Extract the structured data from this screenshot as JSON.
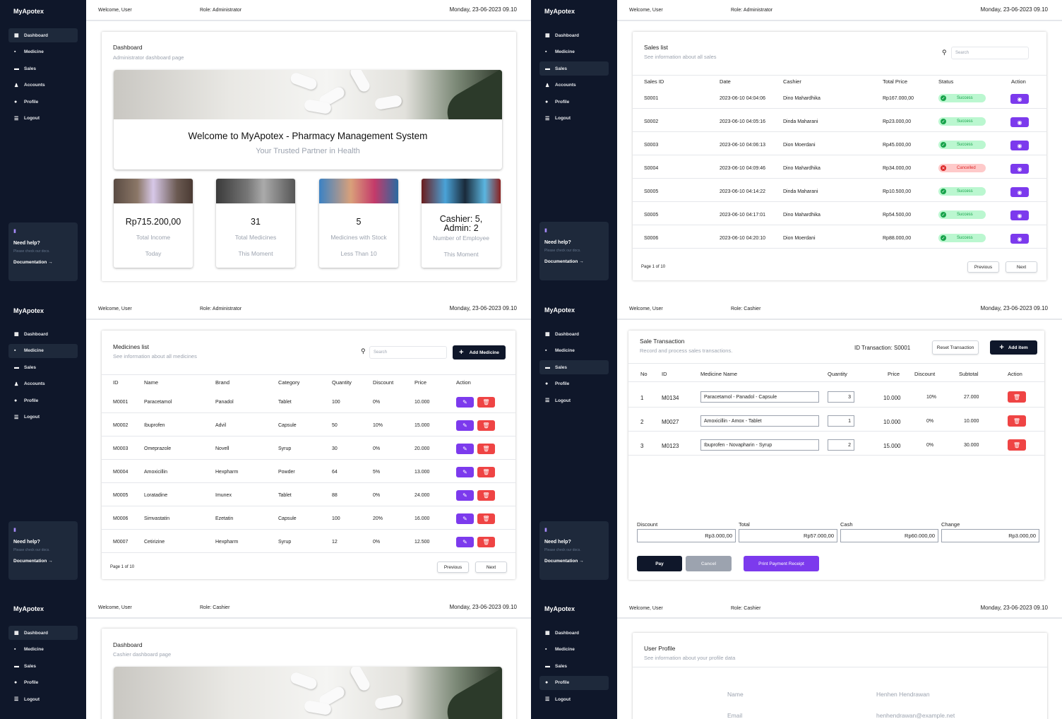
{
  "app": {
    "brand": "MyApotex",
    "welcome": "Welcome, User",
    "role_admin": "Role: Administrator",
    "role_cashier": "Role: Cashier",
    "date": "Monday, 23-06-2023 09.10"
  },
  "nav": {
    "dashboard": "Dashboard",
    "medicine": "Medicine",
    "sales": "Sales",
    "accounts": "Accounts",
    "profile": "Profile",
    "logout": "Logout"
  },
  "help": {
    "title": "Need help?",
    "subtitle": "Please check our docs.",
    "link": "Documentation →"
  },
  "dashboard_admin": {
    "title": "Dashboard",
    "subtitle": "Administrator dashboard page",
    "welcome": "Welcome to MyApotex - Pharmacy Management System",
    "tagline": "Your Trusted Partner in Health",
    "stats": [
      {
        "value": "Rp715.200,00",
        "label": "Total Income",
        "sub": "Today"
      },
      {
        "value": "31",
        "label": "Total Medicines",
        "sub": "This Moment"
      },
      {
        "value": "5",
        "label": "Medicines with Stock",
        "sub": "Less Than 10"
      },
      {
        "value": "Cashier: 5, Admin: 2",
        "label": "Number of Employee",
        "sub": "This Moment"
      }
    ]
  },
  "sales": {
    "title": "Sales list",
    "subtitle": "See information about all sales",
    "search": "Search",
    "headers": [
      "Sales ID",
      "Date",
      "Cashier",
      "Total Price",
      "Status",
      "Action"
    ],
    "rows": [
      {
        "id": "S0001",
        "date": "2023-06-10 04:04:06",
        "cashier": "Dino Mahardhika",
        "total": "Rp167.000,00",
        "status": "Success"
      },
      {
        "id": "S0002",
        "date": "2023-06-10 04:05:16",
        "cashier": "Dinda Maharani",
        "total": "Rp23.000,00",
        "status": "Success"
      },
      {
        "id": "S0003",
        "date": "2023-06-10 04:06:13",
        "cashier": "Dion Moerdani",
        "total": "Rp45.000,00",
        "status": "Success"
      },
      {
        "id": "S0004",
        "date": "2023-06-10 04:09:46",
        "cashier": "Dino Mahardhika",
        "total": "Rp34.000,00",
        "status": "Cancelled"
      },
      {
        "id": "S0005",
        "date": "2023-06-10 04:14:22",
        "cashier": "Dinda Maharani",
        "total": "Rp10.500,00",
        "status": "Success"
      },
      {
        "id": "S0005",
        "date": "2023-06-10 04:17:01",
        "cashier": "Dino Mahardhika",
        "total": "Rp54.500,00",
        "status": "Success"
      },
      {
        "id": "S0006",
        "date": "2023-06-10 04:20:10",
        "cashier": "Dion Moerdani",
        "total": "Rp88.000,00",
        "status": "Success"
      }
    ],
    "page": "Page 1 of 10",
    "prev": "Previous",
    "next": "Next"
  },
  "medicines": {
    "title": "Medicines list",
    "subtitle": "See information about all medicines",
    "search": "Search",
    "add": "Add Medicine",
    "headers": [
      "ID",
      "Name",
      "Brand",
      "Category",
      "Quantity",
      "Discount",
      "Price",
      "Action"
    ],
    "rows": [
      {
        "id": "M0001",
        "name": "Paracetamol",
        "brand": "Panadol",
        "category": "Tablet",
        "qty": "100",
        "disc": "0%",
        "price": "10.000"
      },
      {
        "id": "M0002",
        "name": "Ibuprofen",
        "brand": "Advil",
        "category": "Capsule",
        "qty": "50",
        "disc": "10%",
        "price": "15.000"
      },
      {
        "id": "M0003",
        "name": "Omeprazole",
        "brand": "Novell",
        "category": "Syrup",
        "qty": "30",
        "disc": "0%",
        "price": "20.000"
      },
      {
        "id": "M0004",
        "name": "Amoxicillin",
        "brand": "Hexpharm",
        "category": "Powder",
        "qty": "64",
        "disc": "5%",
        "price": "13.000"
      },
      {
        "id": "M0005",
        "name": "Loratadine",
        "brand": "Imunex",
        "category": "Tablet",
        "qty": "88",
        "disc": "0%",
        "price": "24.000"
      },
      {
        "id": "M0006",
        "name": "Simvastatin",
        "brand": "Ezetatin",
        "category": "Capsule",
        "qty": "100",
        "disc": "20%",
        "price": "16.000"
      },
      {
        "id": "M0007",
        "name": "Cetirizine",
        "brand": "Hexpharm",
        "category": "Syrup",
        "qty": "12",
        "disc": "0%",
        "price": "12.500"
      }
    ],
    "page": "Page 1 of 10",
    "prev": "Previous",
    "next": "Next"
  },
  "transaction": {
    "title": "Sale Transaction",
    "subtitle": "Record and process sales transactions.",
    "id_label": "ID Transaction: S0001",
    "reset": "Reset Transaction",
    "add": "Add item",
    "headers": [
      "No",
      "ID",
      "Medicine Name",
      "Quantity",
      "Price",
      "Discount",
      "Subtotal",
      "Action"
    ],
    "rows": [
      {
        "no": "1",
        "id": "M0134",
        "name": "Paracetamol - Panadol - Capsule",
        "qty": "3",
        "price": "10.000",
        "disc": "10%",
        "subtotal": "27.000"
      },
      {
        "no": "2",
        "id": "M0027",
        "name": "Amoxicillin - Amox - Tablet",
        "qty": "1",
        "price": "10.000",
        "disc": "0%",
        "subtotal": "10.000"
      },
      {
        "no": "3",
        "id": "M0123",
        "name": "Ibuprofen - Novapharin - Syrup",
        "qty": "2",
        "price": "15.000",
        "disc": "0%",
        "subtotal": "30.000"
      }
    ],
    "summary": {
      "discount_label": "Discount",
      "discount": "Rp3.000,00",
      "total_label": "Total",
      "total": "Rp57.000,00",
      "cash_label": "Cash",
      "cash": "Rp60.000,00",
      "change_label": "Change",
      "change": "Rp3.000,00"
    },
    "pay": "Pay",
    "cancel": "Cancel",
    "print": "Print Payment Receipt"
  },
  "dashboard_cashier": {
    "title": "Dashboard",
    "subtitle": "Cashier dashboard page"
  },
  "profile": {
    "title": "User Profile",
    "subtitle": "See information about your profile data",
    "name_label": "Name",
    "name": "Henhen Hendrawan",
    "email_label": "Email",
    "email": "henhendrawan@example.net"
  },
  "colors": {
    "sidebar": "#0f172a",
    "accent": "#7c3aed",
    "danger": "#ef4444",
    "success": "#16a34a"
  }
}
